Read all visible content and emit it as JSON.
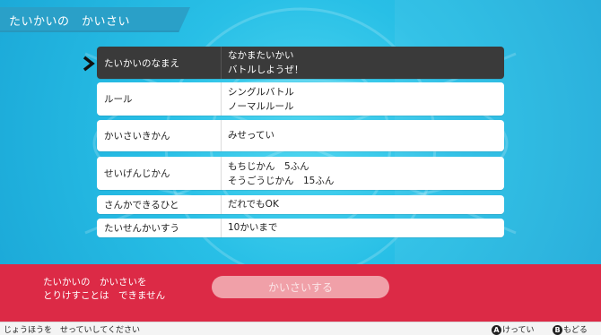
{
  "screen_title": "たいかいの　かいさい",
  "rows": [
    {
      "label": "たいかいのなまえ",
      "value": "なかまたいかい\nバトルしようぜ！",
      "selected": true
    },
    {
      "label": "ルール",
      "value": "シングルバトル\nノーマルルール",
      "selected": false
    },
    {
      "label": "かいさいきかん",
      "value": "みせってい",
      "selected": false
    },
    {
      "label": "せいげんじかん",
      "value": "もちじかん　5ふん\nそうごうじかん　15ふん",
      "selected": false
    },
    {
      "label": "さんかできるひと",
      "value": "だれでもOK",
      "selected": false
    },
    {
      "label": "たいせんかいすう",
      "value": "10かいまで",
      "selected": false
    }
  ],
  "notice": "たいかいの　かいさいを\nとりけすことは　できません",
  "action_button": "かいさいする",
  "footer": {
    "hint": "じょうほうを　せっていしてください",
    "a_icon": "A",
    "a_label": "けってい",
    "b_icon": "B",
    "b_label": "もどる"
  },
  "colors": {
    "background": "#28bfe6",
    "title_bar": "#2aa0c8",
    "selected_row": "#3a3a3a",
    "bottom_panel": "#dc2a46",
    "disabled_button": "#f0a0a8"
  }
}
